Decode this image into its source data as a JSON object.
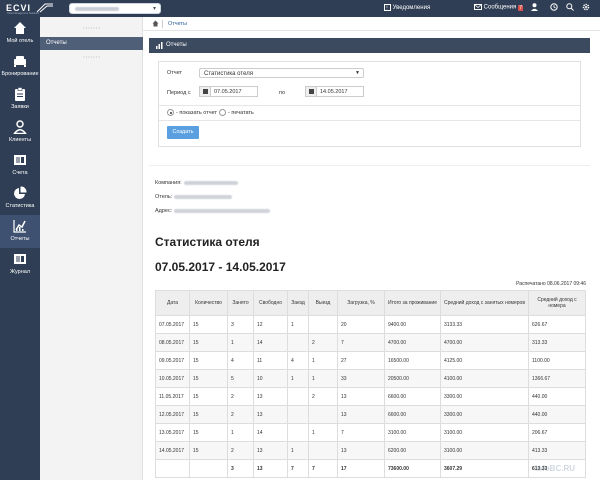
{
  "app": {
    "logo_text": "ECVI",
    "logo_subtitle": "Hotel Management Solutions",
    "notifications_label": "Уведомления",
    "messages_label": "Сообщения",
    "messages_count": "7"
  },
  "sidebar": {
    "items": [
      {
        "label": "Мой отель",
        "icon": "home-icon"
      },
      {
        "label": "Бронирование",
        "icon": "bed-icon"
      },
      {
        "label": "Заявки",
        "icon": "clipboard-icon"
      },
      {
        "label": "Клиенты",
        "icon": "user-icon"
      },
      {
        "label": "Счета",
        "icon": "invoice-icon"
      },
      {
        "label": "Статистика",
        "icon": "pie-chart-icon"
      },
      {
        "label": "Отчеты",
        "icon": "bar-chart-icon"
      },
      {
        "label": "Журнал",
        "icon": "journal-icon"
      }
    ]
  },
  "subnav": {
    "active_item": "Отчеты"
  },
  "breadcrumb": {
    "current": "Отчеты"
  },
  "panel": {
    "title": "Отчеты"
  },
  "form": {
    "report_label": "Отчет",
    "report_value": "Статистика отеля",
    "period_from_label": "Период с",
    "date_from": "07.05.2017",
    "period_to_label": "по",
    "date_to": "14.05.2017",
    "radio_show": "- показать отчет",
    "radio_print": "- печатать",
    "create_button": "Создать"
  },
  "info": {
    "company_label": "Компания:",
    "hotel_label": "Отель:",
    "address_label": "Адрес:"
  },
  "report": {
    "title": "Статистика отеля",
    "range": "07.05.2017 - 14.05.2017",
    "printed": "Распечатано 08.06.2017 09:46",
    "headers": [
      "Дата",
      "Количество",
      "Занято",
      "Свободно",
      "Заезд",
      "Выезд",
      "Загрузка, %",
      "Итого за проживание",
      "Средний доход с занятых номеров",
      "Средний доход с номера"
    ],
    "rows": [
      [
        "07.05.2017",
        "15",
        "3",
        "12",
        "1",
        "",
        "20",
        "9400.00",
        "3133.33",
        "626.67"
      ],
      [
        "08.05.2017",
        "15",
        "1",
        "14",
        "",
        "2",
        "7",
        "4700.00",
        "4700.00",
        "313.33"
      ],
      [
        "09.05.2017",
        "15",
        "4",
        "11",
        "4",
        "1",
        "27",
        "16500.00",
        "4125.00",
        "1100.00"
      ],
      [
        "10.05.2017",
        "15",
        "5",
        "10",
        "1",
        "1",
        "33",
        "20500.00",
        "4100.00",
        "1366.67"
      ],
      [
        "11.05.2017",
        "15",
        "2",
        "13",
        "",
        "2",
        "13",
        "6600.00",
        "3300.00",
        "440.00"
      ],
      [
        "12.05.2017",
        "15",
        "2",
        "13",
        "",
        "",
        "13",
        "6600.00",
        "3300.00",
        "440.00"
      ],
      [
        "13.05.2017",
        "15",
        "1",
        "14",
        "",
        "1",
        "7",
        "3100.00",
        "3100.00",
        "206.67"
      ],
      [
        "14.05.2017",
        "15",
        "2",
        "13",
        "1",
        "",
        "13",
        "6200.00",
        "3100.00",
        "413.33"
      ]
    ],
    "totals": [
      "",
      "",
      "3",
      "13",
      "7",
      "7",
      "17",
      "73600.00",
      "3607.29",
      "613.33"
    ]
  },
  "watermark": "InfoBC.RU",
  "colors": {
    "topbar": "#2f3e54",
    "accent": "#5aa0e0",
    "panel_head": "#3c4a60"
  }
}
